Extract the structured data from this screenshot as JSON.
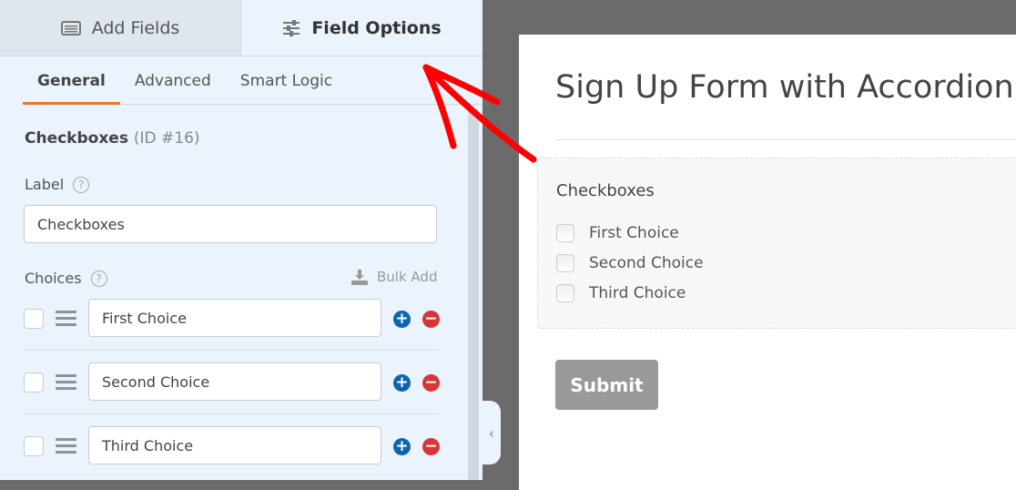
{
  "top_tabs": [
    {
      "label": "Add Fields",
      "icon": "list-icon"
    },
    {
      "label": "Field Options",
      "icon": "sliders-icon"
    }
  ],
  "sub_tabs": [
    {
      "label": "General"
    },
    {
      "label": "Advanced"
    },
    {
      "label": "Smart Logic"
    }
  ],
  "field": {
    "name": "Checkboxes",
    "id_text": "(ID #16)"
  },
  "label_section": {
    "label": "Label",
    "value": "Checkboxes"
  },
  "choices_section": {
    "label": "Choices",
    "bulk_add": "Bulk Add",
    "choices": [
      "First Choice",
      "Second Choice",
      "Third Choice"
    ]
  },
  "preview": {
    "form_title": "Sign Up Form with Accordion",
    "field_label": "Checkboxes",
    "options": [
      "First Choice",
      "Second Choice",
      "Third Choice"
    ],
    "submit": "Submit"
  },
  "colors": {
    "accent_tab": "#e27730",
    "add": "#0c65b0",
    "remove": "#d63638",
    "annotation_arrow": "#ff0000"
  }
}
